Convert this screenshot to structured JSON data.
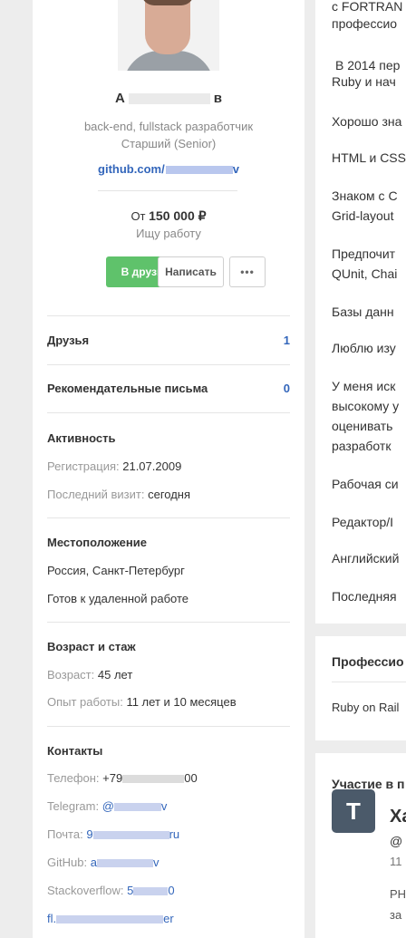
{
  "profile": {
    "name_start": "А",
    "name_end": "в",
    "role": "back-end, fullstack разработчик",
    "level": "Старший (Senior)",
    "github_prefix": "github.com/",
    "github_suffix": "v",
    "salary_prefix": "От",
    "salary_amount": "150 000 ₽",
    "job_status": "Ищу работу",
    "btn_friend": "В друзья",
    "btn_write": "Написать",
    "btn_more": "•••"
  },
  "stats": {
    "friends_label": "Друзья",
    "friends_count": "1",
    "recs_label": "Рекомендательные письма",
    "recs_count": "0"
  },
  "activity": {
    "title": "Активность",
    "reg_label": "Регистрация:",
    "reg_value": "21.07.2009",
    "visit_label": "Последний визит:",
    "visit_value": "сегодня"
  },
  "location": {
    "title": "Местоположение",
    "city": "Россия, Санкт-Петербург",
    "remote": "Готов к удаленной работе"
  },
  "age": {
    "title": "Возраст и стаж",
    "age_label": "Возраст:",
    "age_value": "45 лет",
    "exp_label": "Опыт работы:",
    "exp_value": "11 лет и 10 месяцев"
  },
  "contacts": {
    "title": "Контакты",
    "phone_label": "Телефон:",
    "phone_start": "+79",
    "phone_end": "00",
    "telegram_label": "Telegram:",
    "telegram_start": "@",
    "telegram_end": "v",
    "mail_label": "Почта:",
    "mail_start": "9",
    "mail_end": "ru",
    "github_label": "GitHub:",
    "github_start": "a",
    "github_end": "v",
    "so_label": "Stackoverflow:",
    "so_start": "5",
    "so_end": "0",
    "fl_start": "fl.",
    "fl_end": "er"
  },
  "right": {
    "lines": [
      "с FORTRAN",
      "профессио",
      "В 2014 пер",
      "Ruby  и нач",
      "Хорошо зна",
      "HTML и CSS",
      "Знаком с С",
      "Grid-layout",
      "Предпочит",
      "QUnit, Chai",
      "Базы данн",
      "Люблю изу",
      "У меня иск",
      "высокому у",
      "оценивать",
      "разработк",
      "Рабочая си",
      "Редактор/I",
      "Английский",
      "Последняя"
    ],
    "prof_title": "Профессио",
    "prof_item": "Ruby on Rail",
    "part_title": "Участие в п",
    "part_logo": "T",
    "part_name": "Ха",
    "part_handle": "@",
    "part_num": "11",
    "part_text1": "PH",
    "part_text2": "за"
  }
}
